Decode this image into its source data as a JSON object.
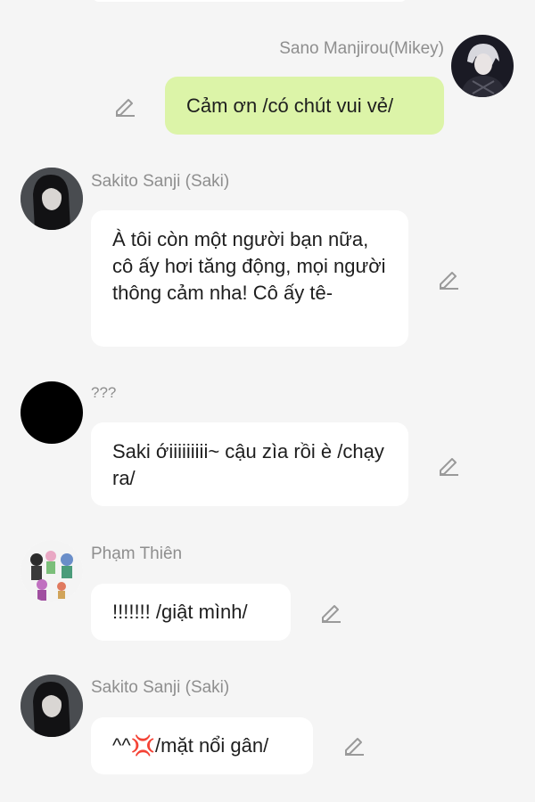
{
  "messages": [
    {
      "id": "m1",
      "sender": "Sano Manjirou(Mikey)",
      "text": "Cảm ơn /có chút vui vẻ/",
      "avatar_icon": "dark-haired-anime-boy-avatar"
    },
    {
      "id": "m2",
      "sender": "Sakito Sanji (Saki)",
      "text": "À tôi còn một người bạn nữa, cô ấy hơi tăng động, mọi người thông cảm nha! Cô ấy tê-",
      "avatar_icon": "dark-haired-anime-girl-avatar"
    },
    {
      "id": "m3",
      "sender": "???",
      "text": "Saki ớiiiiiiiii~ cậu zìa rồi è /chạy ra/",
      "avatar_icon": "black-circle-avatar"
    },
    {
      "id": "m4",
      "sender": "Phạm Thiên",
      "text": "!!!!!!! /giật mình/",
      "avatar_icon": "chibi-group-avatar"
    },
    {
      "id": "m5",
      "sender": "Sakito Sanji (Saki)",
      "text": "^^💢/mặt nổi gân/",
      "avatar_icon": "dark-haired-anime-girl-avatar"
    }
  ],
  "colors": {
    "background": "#f5f5f5",
    "own_bubble": "#dcf4a8",
    "other_bubble": "#ffffff",
    "sender_name": "#8e8e8e"
  },
  "icons": {
    "edit": "pencil-edit-icon"
  }
}
